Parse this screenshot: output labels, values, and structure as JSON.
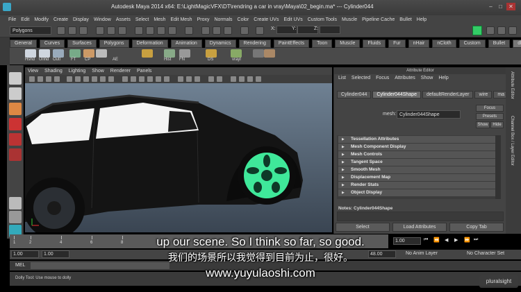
{
  "window": {
    "title": "Autodesk Maya 2014 x64: E:\\LightMagicVFX\\DT\\rendring a car in vray\\Maya\\02_begin.ma*  ---  Cylinder044",
    "controls": [
      "–",
      "□",
      "✕"
    ]
  },
  "menubar": [
    "File",
    "Edit",
    "Modify",
    "Create",
    "Display",
    "Window",
    "Assets",
    "Select",
    "Mesh",
    "Edit Mesh",
    "Proxy",
    "Normals",
    "Color",
    "Create UVs",
    "Edit UVs",
    "Custom Tools",
    "Muscle",
    "Pipeline Cache",
    "Bullet",
    "Help"
  ],
  "statusline": {
    "menu_set": "Polygons",
    "x_label": "X:",
    "y_label": "Y:",
    "z_label": "Z:"
  },
  "shelf": {
    "tabs": [
      "General",
      "Curves",
      "Surfaces",
      "Polygons",
      "Deformation",
      "Animation",
      "Dynamics",
      "Rendering",
      "PaintEffects",
      "Toon",
      "Muscle",
      "Fluids",
      "Fur",
      "nHair",
      "nCloth",
      "Custom",
      "Bullet",
      "dlff"
    ],
    "active_tab": "dlff",
    "icons": [
      "Hshd",
      "Unhd",
      "Outl",
      "FT",
      "CP",
      "AE",
      "Hist",
      "FN",
      "DS",
      "vrayl"
    ]
  },
  "viewport": {
    "menu": [
      "View",
      "Shading",
      "Lighting",
      "Show",
      "Renderer",
      "Panels"
    ],
    "background_top": "#6f8193",
    "background_bottom": "#3a4552",
    "wheel_highlight": "#3fe89a"
  },
  "attribute_editor": {
    "title": "Attribute Editor",
    "menu": [
      "List",
      "Selected",
      "Focus",
      "Attributes",
      "Show",
      "Help"
    ],
    "tabs": [
      "Cylinder044",
      "Cylinder044Shape",
      "defaultRenderLayer",
      "wire",
      "ma"
    ],
    "active_tab": "Cylinder044Shape",
    "mesh_label": "mesh:",
    "mesh_value": "Cylinder044Shape",
    "focus": "Focus",
    "presets": "Presets",
    "show": "Show",
    "hide": "Hide",
    "sections": [
      "Tessellation Attributes",
      "Mesh Component Display",
      "Mesh Controls",
      "Tangent Space",
      "Smooth Mesh",
      "Displacement Map",
      "Render Stats",
      "Object Display"
    ],
    "notes": "Notes: Cylinder044Shape",
    "buttons": [
      "Select",
      "Load Attributes",
      "Copy Tab"
    ],
    "side_tabs": [
      "Attribute Editor",
      "Channel Box / Layer Editor"
    ]
  },
  "timeline": {
    "ticks": [
      "1",
      "2",
      "4",
      "6",
      "8",
      "10",
      "12",
      "14",
      "16",
      "18",
      "20",
      "22",
      "24"
    ],
    "current_frame": "1.00",
    "range_start": "1.00",
    "range_start2": "1.00",
    "range_end": "48.00",
    "anim_layer": "No Anim Layer",
    "character_set": "No Character Set"
  },
  "command_line": {
    "label": "MEL",
    "help": "Dolly Tool: Use mouse to dolly"
  },
  "subtitles": {
    "english": "up our scene. So I think so far, so good.",
    "chinese": "我们的场景所以我觉得到目前为止，很好。",
    "url": "www.yuyulaoshi.com"
  },
  "brand": "pluralsight"
}
